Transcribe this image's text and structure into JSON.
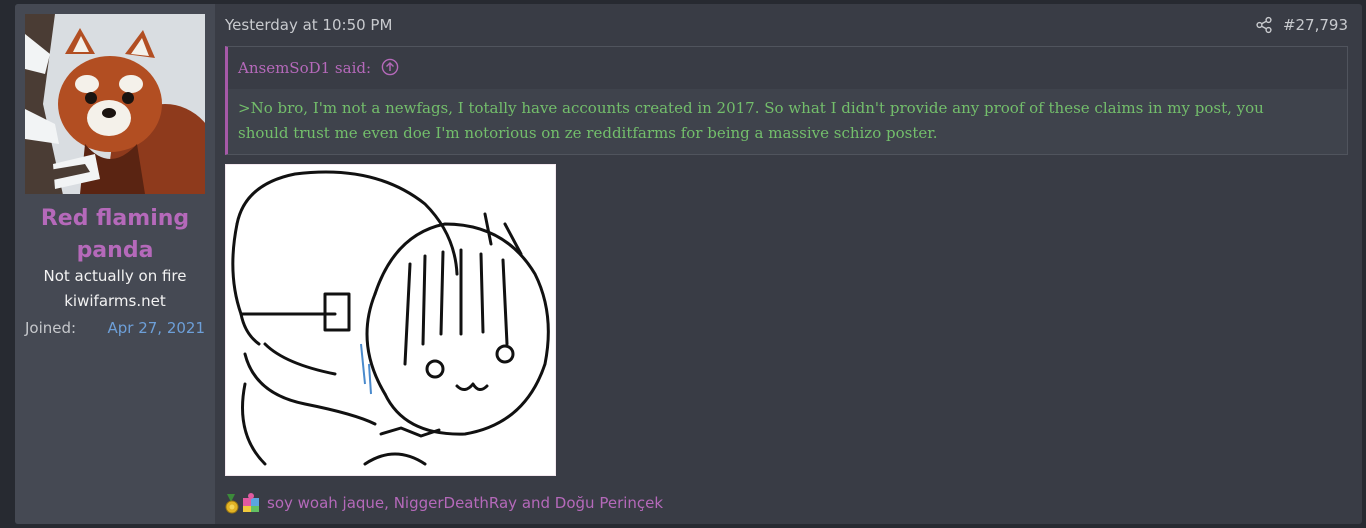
{
  "user": {
    "avatar": "red-panda-avatar",
    "name": "Red flaming panda",
    "title": "Not actually on fire",
    "site": "kiwifarms.net",
    "joined_label": "Joined:",
    "joined_value": "Apr 27, 2021"
  },
  "post": {
    "timestamp": "Yesterday at 10:50 PM",
    "number": "#27,793",
    "share_icon": "share-icon",
    "quote": {
      "author_label": "AnsemSoD1 said:",
      "jump_icon": "arrow-up-circle-icon",
      "line1": ">No bro, I'm not a newfags, I totally have accounts created in 2017. So what I didn't provide any proof of these claims in my post, you",
      "line2": "should trust me even doe I'm notorious on ze redditfarms for being a massive schizo poster."
    },
    "attachment": "soyjak-and-anime-girl-meme-image"
  },
  "reactions": {
    "icons": [
      "medal-icon",
      "puzzle-icon"
    ],
    "text": "soy woah jaque, NiggerDeathRay and Doğu Perinçek"
  },
  "colors": {
    "page_bg": "#272a31",
    "post_bg": "#393c45",
    "user_panel_bg": "#454953",
    "username": "#b569ba",
    "quote_text": "#73be6b",
    "link": "#6d9fd8"
  }
}
